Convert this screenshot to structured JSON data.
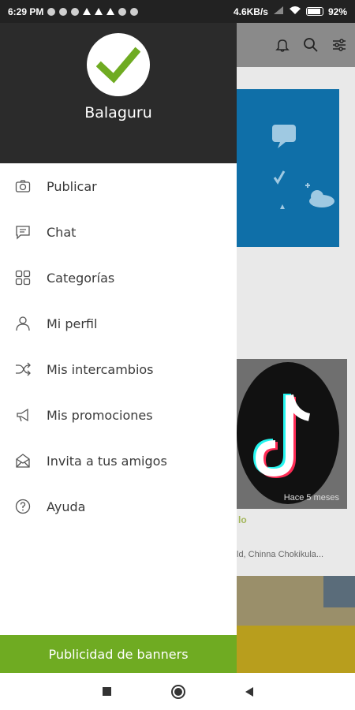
{
  "status_bar": {
    "time": "6:29 PM",
    "network_speed": "4.6KB/s",
    "battery": "92%"
  },
  "drawer": {
    "username": "Balaguru",
    "menu": [
      {
        "label": "Publicar",
        "icon": "camera-icon"
      },
      {
        "label": "Chat",
        "icon": "chat-icon"
      },
      {
        "label": "Categorías",
        "icon": "grid-icon"
      },
      {
        "label": "Mi perfil",
        "icon": "person-icon"
      },
      {
        "label": "Mis intercambios",
        "icon": "shuffle-icon"
      },
      {
        "label": "Mis promociones",
        "icon": "megaphone-icon"
      },
      {
        "label": "Invita a tus amigos",
        "icon": "mail-icon"
      },
      {
        "label": "Ayuda",
        "icon": "help-icon"
      }
    ],
    "banner_button": "Publicidad de banners"
  },
  "background": {
    "listing_time": "Hace 5 meses",
    "listing_title": "lo",
    "listing_desc": "ld, Chinna Chokikula..."
  },
  "colors": {
    "brand_green": "#6fab22",
    "header_dark": "#2b2b2b"
  }
}
